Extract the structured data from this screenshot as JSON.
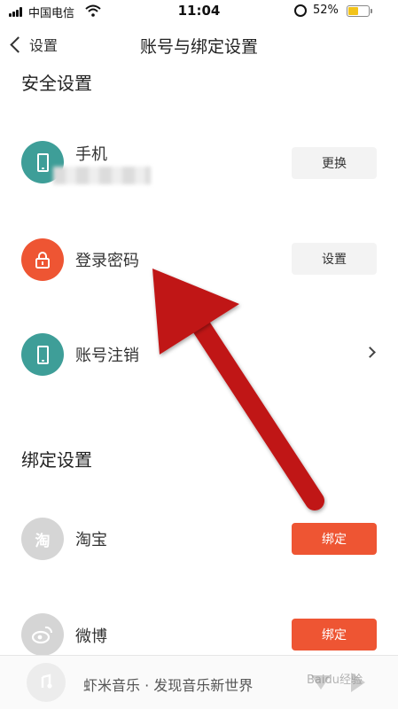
{
  "status_bar": {
    "carrier": "中国电信",
    "time": "11:04",
    "battery_percent": "52%",
    "battery_level": 0.52
  },
  "nav": {
    "back_label": "设置",
    "title": "账号与绑定设置"
  },
  "security": {
    "title": "安全设置",
    "rows": [
      {
        "label": "手机",
        "action": "更换",
        "icon": "phone-icon",
        "icon_color": "#3e9e98"
      },
      {
        "label": "登录密码",
        "action": "设置",
        "icon": "lock-icon",
        "icon_color": "#ee5533"
      },
      {
        "label": "账号注销",
        "icon": "phone-icon",
        "icon_color": "#3e9e98"
      }
    ]
  },
  "binding": {
    "title": "绑定设置",
    "rows": [
      {
        "label": "淘宝",
        "icon_glyph": "淘",
        "action": "绑定",
        "icon": "taobao-icon",
        "icon_color": "#d5d5d5"
      },
      {
        "label": "微博",
        "action": "绑定",
        "icon": "weibo-icon",
        "icon_color": "#d5d5d5"
      }
    ]
  },
  "bottom_bar": {
    "music_text": "虾米音乐 · 发现音乐新世界"
  },
  "colors": {
    "accent": "#ee5533",
    "teal": "#3e9e98",
    "arrow": "#c01418"
  }
}
